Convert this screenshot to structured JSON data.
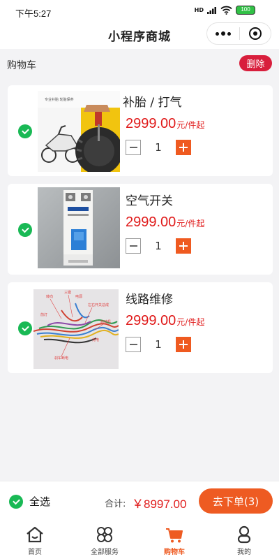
{
  "status": {
    "time": "下午5:27",
    "network": "HD",
    "battery": "100"
  },
  "nav": {
    "title": "小程序商城"
  },
  "cart": {
    "title": "购物车",
    "delete_label": "删除"
  },
  "items": [
    {
      "name": "补胎 / 打气",
      "price": "2999.00",
      "unit": "元/件起",
      "qty": "1",
      "checked": true,
      "image": "motorcycle-tire-repair-photo"
    },
    {
      "name": "空气开关",
      "price": "2999.00",
      "unit": "元/件起",
      "qty": "1",
      "checked": true,
      "image": "circuit-breaker-photo"
    },
    {
      "name": "线路维修",
      "price": "2999.00",
      "unit": "元/件起",
      "qty": "1",
      "checked": true,
      "image": "wiring-harness-photo"
    }
  ],
  "checkout": {
    "select_all": "全选",
    "total_label": "合计:",
    "total_value": "￥8997.00",
    "order_label": "去下单(3)"
  },
  "tabs": [
    {
      "label": "首页",
      "icon": "home-icon",
      "active": false
    },
    {
      "label": "全部服务",
      "icon": "grid-icon",
      "active": false
    },
    {
      "label": "购物车",
      "icon": "cart-icon",
      "active": true
    },
    {
      "label": "我的",
      "icon": "profile-icon",
      "active": false
    }
  ],
  "colors": {
    "accent": "#ee5b22",
    "price": "#e01b1b",
    "check": "#19b955",
    "delete": "#d81e3c"
  }
}
